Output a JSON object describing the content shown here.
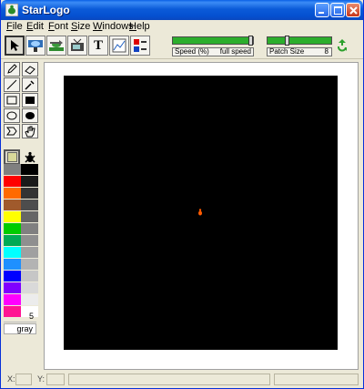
{
  "window": {
    "title": "StarLogo",
    "icon": "starlogo-app-icon",
    "controls": [
      "minimize-icon",
      "maximize-icon",
      "close-icon"
    ]
  },
  "menu": [
    {
      "key": "F",
      "rest": "ile"
    },
    {
      "key": "E",
      "rest": "dit"
    },
    {
      "key": "F",
      "rest": "ont"
    },
    {
      "key": "S",
      "rest": "ize"
    },
    {
      "key": "W",
      "rest": "indows"
    },
    {
      "key": "H",
      "rest": "elp"
    }
  ],
  "toolbar": {
    "tools": [
      "pointer-icon",
      "turtle-stamp-icon",
      "turtle-move-icon",
      "tv-monitor-icon",
      "text-icon",
      "graph-icon",
      "palette-list-icon"
    ],
    "text_tool_label": "T",
    "speed_slider": {
      "label": "Speed (%)",
      "right_label": "full speed",
      "level_percent": 100
    },
    "patch_slider": {
      "label": "Patch Size",
      "value": "8",
      "level_percent": 30
    },
    "recycle_icon": "recycle-icon"
  },
  "palette": {
    "draw_tools": [
      "pencil-icon",
      "eraser-icon",
      "line-icon",
      "eyedropper-icon",
      "rectangle-outline-icon",
      "rectangle-filled-icon",
      "ellipse-outline-icon",
      "ellipse-filled-icon",
      "stamp-icon",
      "hand-icon"
    ],
    "shape_modes": [
      "patch-square-icon",
      "turtle-shape-icon"
    ],
    "colors_left": [
      "#808080",
      "#ff0000",
      "#ff6a00",
      "#a05a2c",
      "#ffff00",
      "#00cc00",
      "#00aa55",
      "#00ffff",
      "#1e90ff",
      "#0000ff",
      "#8000ff",
      "#ff00ff",
      "#ff1493"
    ],
    "colors_right": [
      "#000000",
      "#1a1a1a",
      "#333333",
      "#4d4d4d",
      "#666666",
      "#808080",
      "#8f8f8f",
      "#a0a0a0",
      "#b3b3b3",
      "#c6c6c6",
      "#d9d9d9",
      "#ececec",
      "#ffffff"
    ],
    "selected_color_number": "5",
    "selected_color_name": "gray"
  },
  "canvas": {
    "background": "#000000",
    "turtle_color": "#ff5a00"
  },
  "status": {
    "x_label": "X:",
    "y_label": "Y:",
    "x_value": "",
    "y_value": ""
  }
}
